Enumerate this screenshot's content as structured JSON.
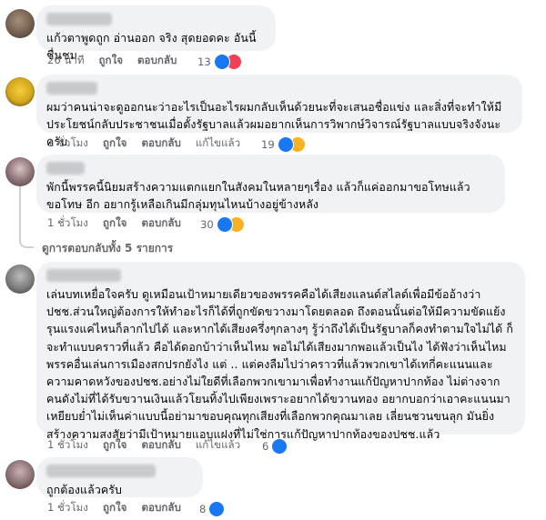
{
  "comments": [
    {
      "text": "แก้วตาพูดถูก อ่านออก จริง สุดยอดคะ อันนี้ ชื่นชม",
      "time": "26 นาที",
      "like": "ถูกใจ",
      "reply": "ตอบกลับ",
      "edited": "",
      "count": "13",
      "reactions": [
        "like-icon",
        "love-icon"
      ]
    },
    {
      "text": "ผมว่าคนน่าจะดูออกนะว่าอะไรเป็นอะไรผมกลับเห็นด้วยนะที่จะเสนอชื่อแข่ง และสิ่งที่จะทำให้มีประโยชน์กลับประชาชนเมื่อตั้งรัฐบาลแล้วผมอยากเห็นการวิพากษ์วิจารณ์รัฐบาลแบบจริงจังนะครับ",
      "time": "1 ชั่วโมง",
      "like": "ถูกใจ",
      "reply": "ตอบกลับ",
      "edited": "แก้ไขแล้ว",
      "count": "19",
      "reactions": [
        "like-icon",
        "haha-icon"
      ]
    },
    {
      "text": "พักนี้พรรคนี้นิยมสร้างความแตกแยกในสังคมในหลายๆเรื่อง แล้วก็แค่ออกมาขอโทษแล้วขอโทษ อีก อยากรู้เหลือเกินมีกลุ่มทุนไหนบ้างอยู่ข้างหลัง",
      "time": "1 ชั่วโมง",
      "like": "ถูกใจ",
      "reply": "ตอบกลับ",
      "edited": "",
      "count": "30",
      "reactions": [
        "like-icon",
        "haha-icon"
      ]
    },
    {
      "text": "เล่นบทเหยื่อใจครับ ดูเหมือนเป้าหมายเดียวของพรรคคือได้เสียงแลนด์สไลด์เพื่อมีข้ออ้างว่าปชช.ส่วนใหญ่ต้องการให้ทำอะไรก็ได้ที่ถูกขัดขวางมาโดยตลอด ถึงตอนนั้นต่อให้มีความขัดแย้งรุนแรงแค่ไหนก็ลากไปได้ และหากได้เสียงครึ่งๆกลางๆ รู้ว่าถึงได้เป็นรัฐบาลก็คงทำตามใจไม่ได้ ก็จะทำแบบคราวที่แล้ว คือได้ดอกบ้าว่าเห็นไหม พอไม่ได้เสียงมากพอแล้วเป็นไง ได้ฟังว่าเห็นไหมพรรคอื่นเล่นการเมืองสกปรกยังไง แต่ .. แต่คงลืมไปว่าคราวที่แล้วพวกเขาได้เทกี่คะแนนและความคาดหวังของปชช.อย่างไม่ใยดีที่เลือกพวกเขามาเพื่อทำงานแก้ปัญหาปากท้อง ไม่ต่างจากคนดังไม่ที่ได้รับขวานเงินแล้วโยนทิ้งไปเพียงเพราะอยากได้ขวานทอง อยากบอกว่าเอาคะแนนมาเหยียบย่ำไม่เห็นค่าแบบนี้อย่ามาขอบคุณทุกเสียงที่เลือกพวกคุณมาเลย เลี่ยนชวนขนลุก มันยิ่งสร้างความสงสัยว่ามีเป้าหมายแอบแฝงที่ไม่ใช่การแก้ปัญหาปากท้องของปชช.แล้ว",
      "time": "1 ชั่วโมง",
      "like": "ถูกใจ",
      "reply": "ตอบกลับ",
      "edited": "แก้ไขแล้ว",
      "count": "6",
      "reactions": [
        "like-icon"
      ]
    },
    {
      "text": "ถูกต้องแล้วครับ",
      "time": "1 ชั่วโมง",
      "like": "ถูกใจ",
      "reply": "ตอบกลับ",
      "edited": "",
      "count": "8",
      "reactions": [
        "like-icon"
      ]
    }
  ],
  "view_replies": "ดูการตอบกลับทั้ง 5 รายการ",
  "colors": {
    "bubble": "#f0f2f5",
    "meta_text": "#65676b",
    "like": "#1877f2",
    "love": "#f33e58",
    "haha": "#f7b125"
  }
}
